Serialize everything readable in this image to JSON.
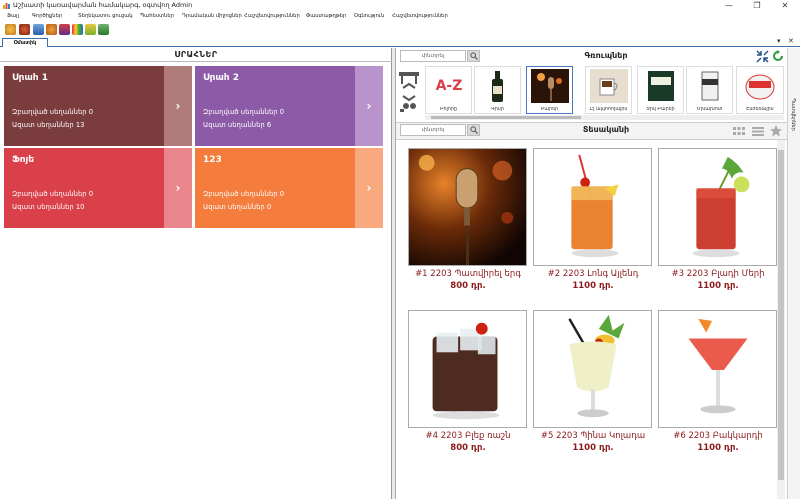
{
  "window": {
    "title": "Աշխատի կառավարման համակարգ, օգտվող Admin",
    "minimize_glyph": "—",
    "maximize_glyph": "❐",
    "close_glyph": "✕"
  },
  "menu": [
    "Ֆայլ",
    "Գործիքներ",
    "Տեղեկատու ցուցակ",
    "Պահեստներ",
    "Դրամական միջոցներ",
    "Հաշվետվություններ",
    "Փաստաթղթեր",
    "Օգնություն",
    "Հաշվետվություններ"
  ],
  "doc_tab": {
    "label": "Օմատիկ",
    "ctrl1": "▾",
    "ctrl2": "✕"
  },
  "left": {
    "title": "ՍՐԱՀՆԵՐ",
    "halls": [
      {
        "name": "Սրահ 1",
        "reserved": "Զբաղված սեղաններ 0",
        "free": "Ազատ սեղաններ 13",
        "color": "#7a3c3c",
        "btn": "#b07b7b"
      },
      {
        "name": "Սրահ 2",
        "reserved": "Զբաղված սեղաններ 0",
        "free": "Ազատ սեղաններ 6",
        "color": "#8d5aa8",
        "btn": "#b893cc"
      },
      {
        "name": "Ֆոյե",
        "reserved": "Զբաղված սեղաններ 0",
        "free": "Ազատ սեղաններ 10",
        "color": "#d9404a",
        "btn": "#e8868c"
      },
      {
        "name": "123",
        "reserved": "Զբաղված սեղաններ 0",
        "free": "Ազատ սեղաններ 0",
        "color": "#f47c3c",
        "btn": "#f8a97d"
      }
    ],
    "go_glyph": "›"
  },
  "right": {
    "search1_placeholder": "փնտրել",
    "groups_title": "Գռուպներ",
    "categories": [
      {
        "label": "Բոլորը"
      },
      {
        "label": "Գինի"
      },
      {
        "label": "Բարեր"
      },
      {
        "label": "Ըլ ալկոհոլային"
      },
      {
        "label": "Ցիկ Բարեր"
      },
      {
        "label": "Ծխախոտ"
      },
      {
        "label": "Էնժեռային"
      }
    ],
    "az_text": "A-Z",
    "search2_placeholder": "փնտրել",
    "items_title": "Տեսականի",
    "products": [
      {
        "name": "#1 2203 Պատվիրել երգ",
        "price": "800 դր."
      },
      {
        "name": "#2 2203 Լոնգ Այլենդ",
        "price": "1100 դր."
      },
      {
        "name": "#3 2203 Բլադի Մերի",
        "price": "1100 դր."
      },
      {
        "name": "#4 2203 Բլեք ռաշն",
        "price": "800 դր."
      },
      {
        "name": "#5 2203 Պինա Կոլադա",
        "price": "1100 դր."
      },
      {
        "name": "#6 2203 Բակկարդի",
        "price": "1100 դր."
      }
    ],
    "side_tab": "Պատվերներ"
  }
}
